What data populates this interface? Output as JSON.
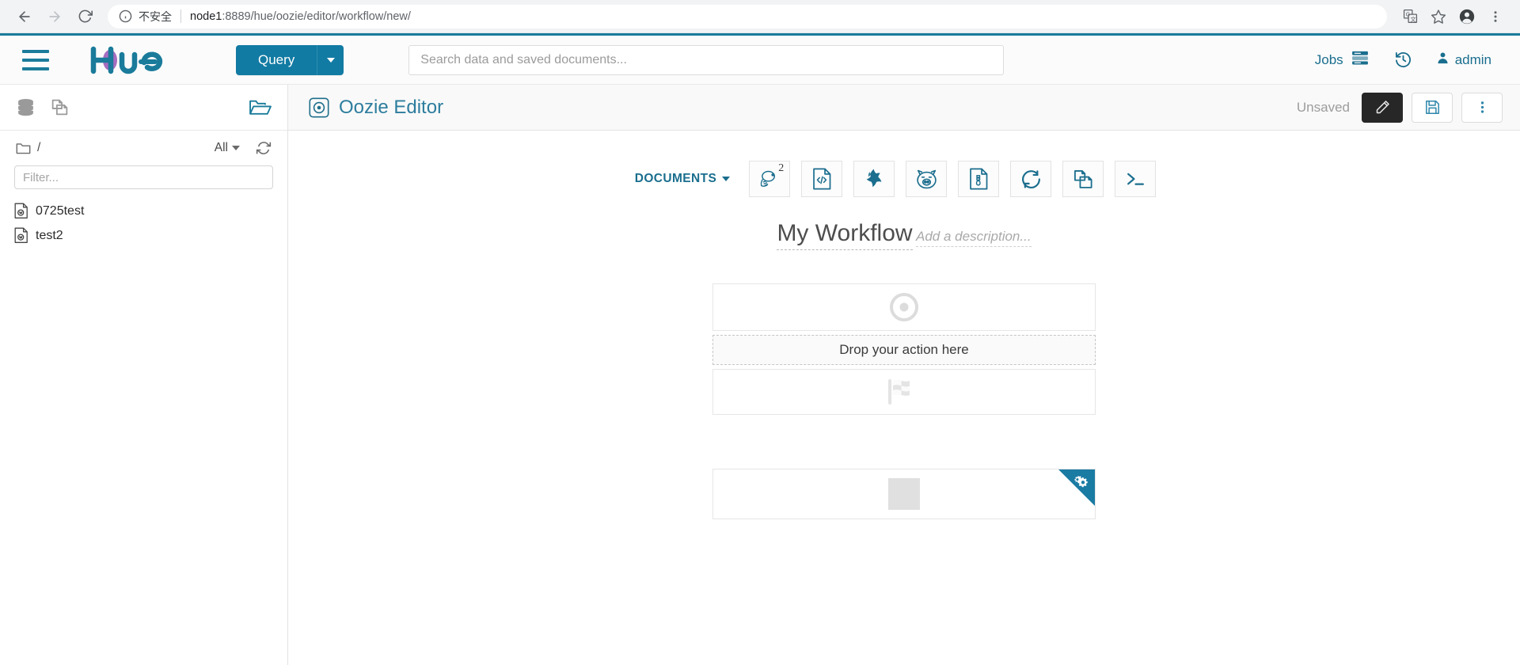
{
  "browser": {
    "back_icon": "arrow-left-icon",
    "forward_icon": "arrow-right-icon",
    "reload_icon": "reload-icon",
    "security_label": "不安全",
    "url_host": "node1",
    "url_path": ":8889/hue/oozie/editor/workflow/new/",
    "translate_icon": "translate-icon",
    "bookmark_icon": "star-icon",
    "profile_icon": "account-icon",
    "menu_icon": "kebab-menu-icon"
  },
  "navbar": {
    "menu_icon": "hamburger-icon",
    "logo_text": "hue",
    "query_label": "Query",
    "query_caret_icon": "chevron-down-icon",
    "search_placeholder": "Search data and saved documents...",
    "search_value": "",
    "jobs_label": "Jobs",
    "jobs_icon": "jobs-list-icon",
    "history_icon": "history-clock-icon",
    "user_label": "admin",
    "user_icon": "user-icon",
    "accent_color": "#127ba3"
  },
  "sidebar": {
    "tools": [
      {
        "name": "database-icon",
        "label": "Databases"
      },
      {
        "name": "documents-icon",
        "label": "Documents"
      }
    ],
    "open_folder_icon": "open-folder-icon",
    "path": "/",
    "path_folder_icon": "folder-icon",
    "type_filter_label": "All",
    "type_filter_caret_icon": "caret-down-icon",
    "refresh_icon": "refresh-icon",
    "filter_placeholder": "Filter...",
    "filter_value": "",
    "documents": [
      {
        "name": "0725test",
        "icon": "workflow-doc-icon"
      },
      {
        "name": "test2",
        "icon": "workflow-doc-icon"
      }
    ]
  },
  "editor": {
    "title": "Oozie Editor",
    "title_icon": "oozie-circle-icon",
    "status": "Unsaved",
    "edit_icon": "pencil-icon",
    "save_icon": "floppy-save-icon",
    "more_icon": "vertical-dots-icon"
  },
  "action_bar": {
    "documents_label": "DOCUMENTS",
    "documents_caret_icon": "caret-down-icon",
    "actions": [
      {
        "name": "hive-action",
        "icon": "hive-bee-icon",
        "badge": "2"
      },
      {
        "name": "code-action",
        "icon": "code-document-icon",
        "badge": ""
      },
      {
        "name": "spark-action",
        "icon": "spark-star-icon",
        "badge": ""
      },
      {
        "name": "pig-action",
        "icon": "pig-icon",
        "badge": ""
      },
      {
        "name": "sqoop-action",
        "icon": "zip-document-icon",
        "badge": ""
      },
      {
        "name": "java-action",
        "icon": "circle-loop-icon",
        "badge": ""
      },
      {
        "name": "subworkflow-action",
        "icon": "copy-documents-icon",
        "badge": ""
      },
      {
        "name": "shell-action",
        "icon": "terminal-prompt-icon",
        "badge": ""
      }
    ]
  },
  "workflow": {
    "name": "My Workflow",
    "description_placeholder": "Add a description...",
    "nodes": [
      {
        "name": "start-node",
        "icon": "start-circle-icon"
      },
      {
        "name": "drop-zone",
        "label": "Drop your action here"
      },
      {
        "name": "end-node",
        "icon": "checkered-flag-icon"
      },
      {
        "name": "kill-node",
        "icon": "kill-square-icon",
        "corner_icon": "gears-icon"
      }
    ],
    "dropzone_label": "Drop your action here"
  }
}
